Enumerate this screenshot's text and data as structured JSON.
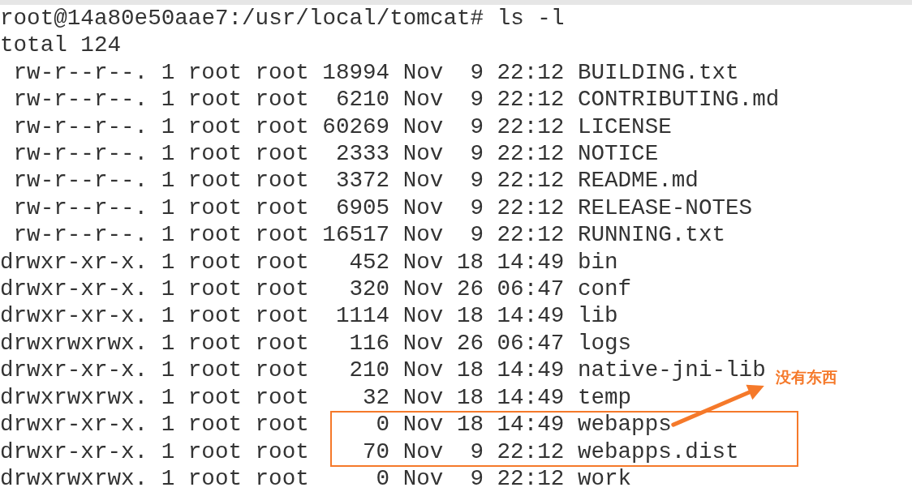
{
  "terminal": {
    "prompt": "root@14a80e50aae7:/usr/local/tomcat#",
    "command": "ls -l",
    "total": "total 124",
    "entries": [
      {
        "perms": "rw-r--r--.",
        "links": "1",
        "owner": "root",
        "group": "root",
        "size": "18994",
        "month": "Nov",
        "day": "9",
        "time": "22:12",
        "name": "BUILDING.txt",
        "highlighted": false
      },
      {
        "perms": "rw-r--r--.",
        "links": "1",
        "owner": "root",
        "group": "root",
        "size": "6210",
        "month": "Nov",
        "day": "9",
        "time": "22:12",
        "name": "CONTRIBUTING.md",
        "highlighted": false
      },
      {
        "perms": "rw-r--r--.",
        "links": "1",
        "owner": "root",
        "group": "root",
        "size": "60269",
        "month": "Nov",
        "day": "9",
        "time": "22:12",
        "name": "LICENSE",
        "highlighted": false
      },
      {
        "perms": "rw-r--r--.",
        "links": "1",
        "owner": "root",
        "group": "root",
        "size": "2333",
        "month": "Nov",
        "day": "9",
        "time": "22:12",
        "name": "NOTICE",
        "highlighted": false
      },
      {
        "perms": "rw-r--r--.",
        "links": "1",
        "owner": "root",
        "group": "root",
        "size": "3372",
        "month": "Nov",
        "day": "9",
        "time": "22:12",
        "name": "README.md",
        "highlighted": false
      },
      {
        "perms": "rw-r--r--.",
        "links": "1",
        "owner": "root",
        "group": "root",
        "size": "6905",
        "month": "Nov",
        "day": "9",
        "time": "22:12",
        "name": "RELEASE-NOTES",
        "highlighted": false
      },
      {
        "perms": "rw-r--r--.",
        "links": "1",
        "owner": "root",
        "group": "root",
        "size": "16517",
        "month": "Nov",
        "day": "9",
        "time": "22:12",
        "name": "RUNNING.txt",
        "highlighted": false
      },
      {
        "perms": "drwxr-xr-x.",
        "links": "1",
        "owner": "root",
        "group": "root",
        "size": "452",
        "month": "Nov",
        "day": "18",
        "time": "14:49",
        "name": "bin",
        "highlighted": false
      },
      {
        "perms": "drwxr-xr-x.",
        "links": "1",
        "owner": "root",
        "group": "root",
        "size": "320",
        "month": "Nov",
        "day": "26",
        "time": "06:47",
        "name": "conf",
        "highlighted": false
      },
      {
        "perms": "drwxr-xr-x.",
        "links": "1",
        "owner": "root",
        "group": "root",
        "size": "1114",
        "month": "Nov",
        "day": "18",
        "time": "14:49",
        "name": "lib",
        "highlighted": false
      },
      {
        "perms": "drwxrwxrwx.",
        "links": "1",
        "owner": "root",
        "group": "root",
        "size": "116",
        "month": "Nov",
        "day": "26",
        "time": "06:47",
        "name": "logs",
        "highlighted": false
      },
      {
        "perms": "drwxr-xr-x.",
        "links": "1",
        "owner": "root",
        "group": "root",
        "size": "210",
        "month": "Nov",
        "day": "18",
        "time": "14:49",
        "name": "native-jni-lib",
        "highlighted": false
      },
      {
        "perms": "drwxrwxrwx.",
        "links": "1",
        "owner": "root",
        "group": "root",
        "size": "32",
        "month": "Nov",
        "day": "18",
        "time": "14:49",
        "name": "temp",
        "highlighted": false
      },
      {
        "perms": "drwxr-xr-x.",
        "links": "1",
        "owner": "root",
        "group": "root",
        "size": "0",
        "month": "Nov",
        "day": "18",
        "time": "14:49",
        "name": "webapps",
        "highlighted": true
      },
      {
        "perms": "drwxr-xr-x.",
        "links": "1",
        "owner": "root",
        "group": "root",
        "size": "70",
        "month": "Nov",
        "day": "9",
        "time": "22:12",
        "name": "webapps.dist",
        "highlighted": true
      },
      {
        "perms": "drwxrwxrwx.",
        "links": "1",
        "owner": "root",
        "group": "root",
        "size": "0",
        "month": "Nov",
        "day": "9",
        "time": "22:12",
        "name": "work",
        "highlighted": false
      }
    ]
  },
  "annotation": {
    "text": "没有东西"
  }
}
